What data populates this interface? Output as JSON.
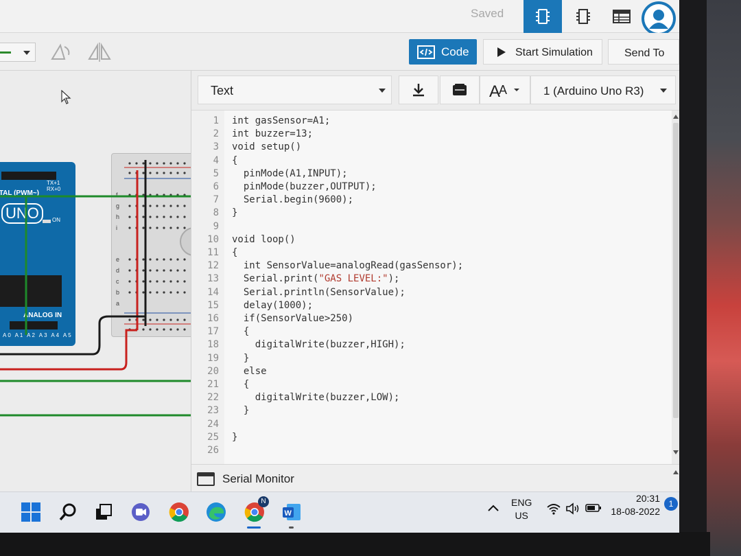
{
  "topbar": {
    "saved_label": "Saved"
  },
  "toolbar": {
    "code_label": "Code",
    "start_simulation_label": "Start Simulation",
    "send_to_label": "Send To"
  },
  "code_toolbar": {
    "mode_value": "Text",
    "board_value": "1 (Arduino Uno R3)"
  },
  "editor": {
    "line_numbers": [
      "1",
      "2",
      "3",
      "4",
      "5",
      "6",
      "7",
      "8",
      "9",
      "10",
      "11",
      "12",
      "13",
      "14",
      "15",
      "16",
      "17",
      "18",
      "19",
      "20",
      "21",
      "22",
      "23",
      "24",
      "25",
      "26"
    ],
    "lines": [
      "int gasSensor=A1;",
      "int buzzer=13;",
      "void setup()",
      "{",
      "  pinMode(A1,INPUT);",
      "  pinMode(buzzer,OUTPUT);",
      "  Serial.begin(9600);",
      "}",
      "",
      "void loop()",
      "{",
      "  int SensorValue=analogRead(gasSensor);",
      "  Serial.print(\"GAS LEVEL:\");",
      "  Serial.println(SensorValue);",
      "  delay(1000);",
      "  if(SensorValue>250)",
      "  {",
      "    digitalWrite(buzzer,HIGH);",
      "  }",
      "  else",
      "  {",
      "    digitalWrite(buzzer,LOW);",
      "  }",
      "",
      "}",
      ""
    ]
  },
  "serial_monitor": {
    "label": "Serial Monitor"
  },
  "arduino": {
    "board_label": "UNO",
    "digital_label": "ITAL (PWM~)",
    "analog_label": "ANALOG IN",
    "on_label": "ON",
    "pin_labels": [
      "A0",
      "A1",
      "A2",
      "A3",
      "A4",
      "A5"
    ],
    "tx_rx": "TX+1 RX+0"
  },
  "breadboard": {
    "row_letters_top": [
      "f",
      "g",
      "h",
      "i"
    ],
    "row_letters_bottom": [
      "a",
      "b",
      "c",
      "d",
      "e"
    ]
  },
  "taskbar": {
    "lang_line1": "ENG",
    "lang_line2": "US",
    "time": "20:31",
    "date": "18-08-2022",
    "notification_count": "1",
    "chrome_badge": "N"
  },
  "colors": {
    "accent": "#1b77b8",
    "arduino_blue": "#0f6aa8",
    "wire_green": "#1e8a2a",
    "wire_red": "#c8211e",
    "string_red": "#b03a2e"
  }
}
